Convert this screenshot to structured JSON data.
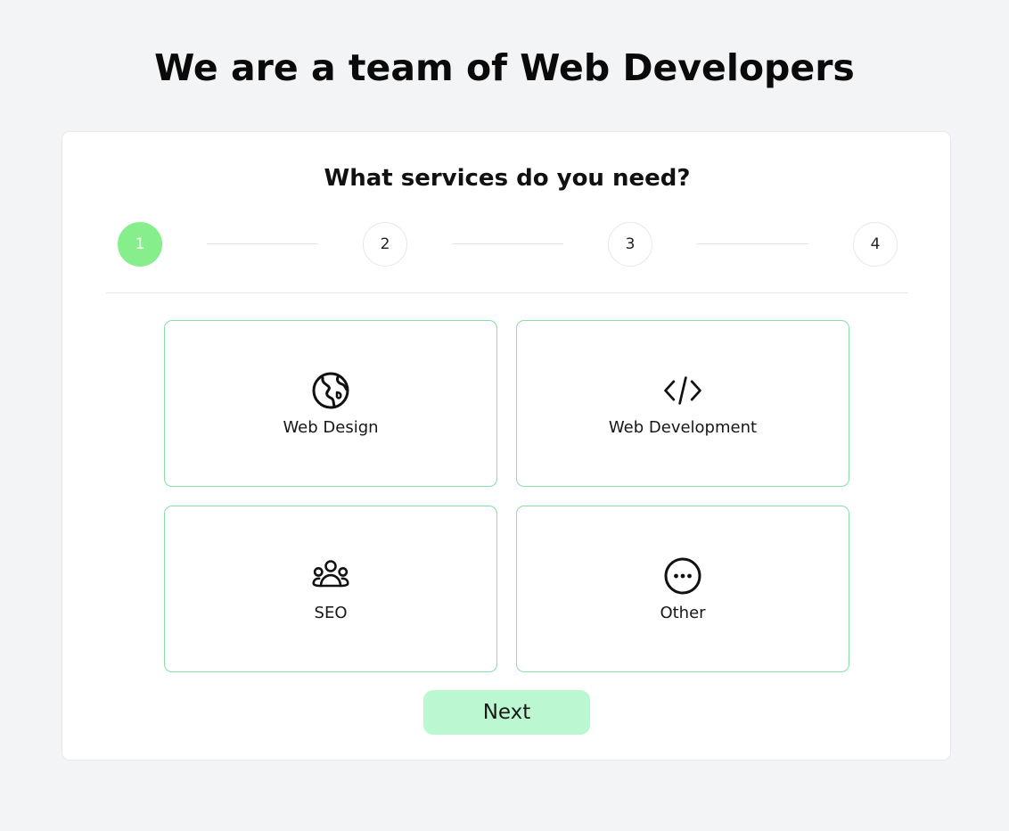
{
  "header": {
    "title": "We are a team of Web Developers"
  },
  "form": {
    "question": "What services do you need?",
    "steps": [
      {
        "label": "1",
        "active": true
      },
      {
        "label": "2",
        "active": false
      },
      {
        "label": "3",
        "active": false
      },
      {
        "label": "4",
        "active": false
      }
    ],
    "options": [
      {
        "label": "Web Design",
        "icon": "globe-icon"
      },
      {
        "label": "Web Development",
        "icon": "code-icon"
      },
      {
        "label": "SEO",
        "icon": "users-group-icon"
      },
      {
        "label": "Other",
        "icon": "ellipsis-circle-icon"
      }
    ],
    "next_label": "Next"
  },
  "colors": {
    "page_background": "#f3f4f6",
    "active_step": "#86ef8c",
    "option_border": "#86e0a8",
    "next_button": "#bbf7d0"
  }
}
